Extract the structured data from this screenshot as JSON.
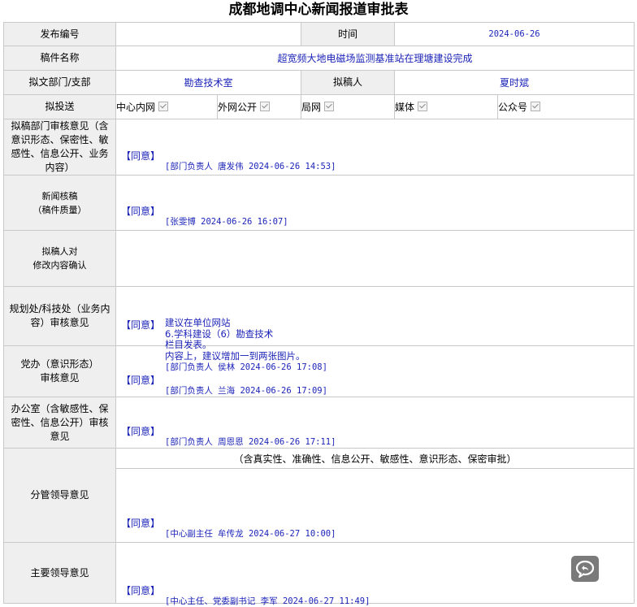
{
  "title": "成都地调中心新闻报道审批表",
  "header": {
    "fabu_label": "发布编号",
    "fabu_value": "",
    "time_label": "时间",
    "time_value": "2024-06-26",
    "gaojian_label": "稿件名称",
    "gaojian_value": "超宽频大地电磁场监测基准站在理塘建设完成",
    "bumen_label": "拟文部门/支部",
    "bumen_value": "勘查技术室",
    "nigao_label": "拟稿人",
    "nigao_value": "夏时斌"
  },
  "distribution": {
    "label": "拟投送",
    "options": [
      {
        "label": "中心内网",
        "checked": true
      },
      {
        "label": "外网公开",
        "checked": true
      },
      {
        "label": "局网",
        "checked": true
      },
      {
        "label": "媒体",
        "checked": true
      },
      {
        "label": "公众号",
        "checked": true
      }
    ]
  },
  "rows": {
    "r1_label": "拟稿部门审核意见（含意识形态、保密性、敏感性、信息公开、业务内容）",
    "r1_agree": "【同意】",
    "r1_sign": "[部门负责人  唐发伟  2024-06-26 14:53]",
    "r2_label1": "新闻核稿",
    "r2_label2": "（稿件质量）",
    "r2_agree": "【同意】",
    "r2_sign": "[张雯博  2024-06-26 16:07]",
    "r3_label1": "拟稿人对",
    "r3_label2": "修改内容确认",
    "r4_label": "规划处/科技处（业务内容）审核意见",
    "r4_agree": "【同意】",
    "r4_note1": " 建议在单位网站",
    "r4_note2": "6.学科建设（6）勘查技术",
    "r4_note3": "栏目发表。",
    "r4_note4": "内容上，建议增加一到两张图片。",
    "r4_sign": "[部门负责人  侯林  2024-06-26 17:08]",
    "r5_label": "党办（意识形态）审核意见",
    "r5_agree": "【同意】",
    "r5_sign": "[部门负责人  兰海  2024-06-26 17:09]",
    "r6_label": "办公室（含敏感性、保密性、信息公开）审核意见",
    "r6_agree": "【同意】",
    "r6_sign": "[部门负责人  周恩恩  2024-06-26 17:11]",
    "r7_label": "分管领导意见",
    "r7_note": "（含真实性、准确性、信息公开、敏感性、意识形态、保密审批）",
    "r7_agree": "【同意】",
    "r7_sign": "[中心副主任  牟传龙  2024-06-27 10:00]",
    "r8_label": "主要领导意见",
    "r8_agree": "【同意】",
    "r8_sign": "[中心主任、党委副书记  李军  2024-06-27 11:49]"
  },
  "float_button_icon": "chat-bubble-icon"
}
